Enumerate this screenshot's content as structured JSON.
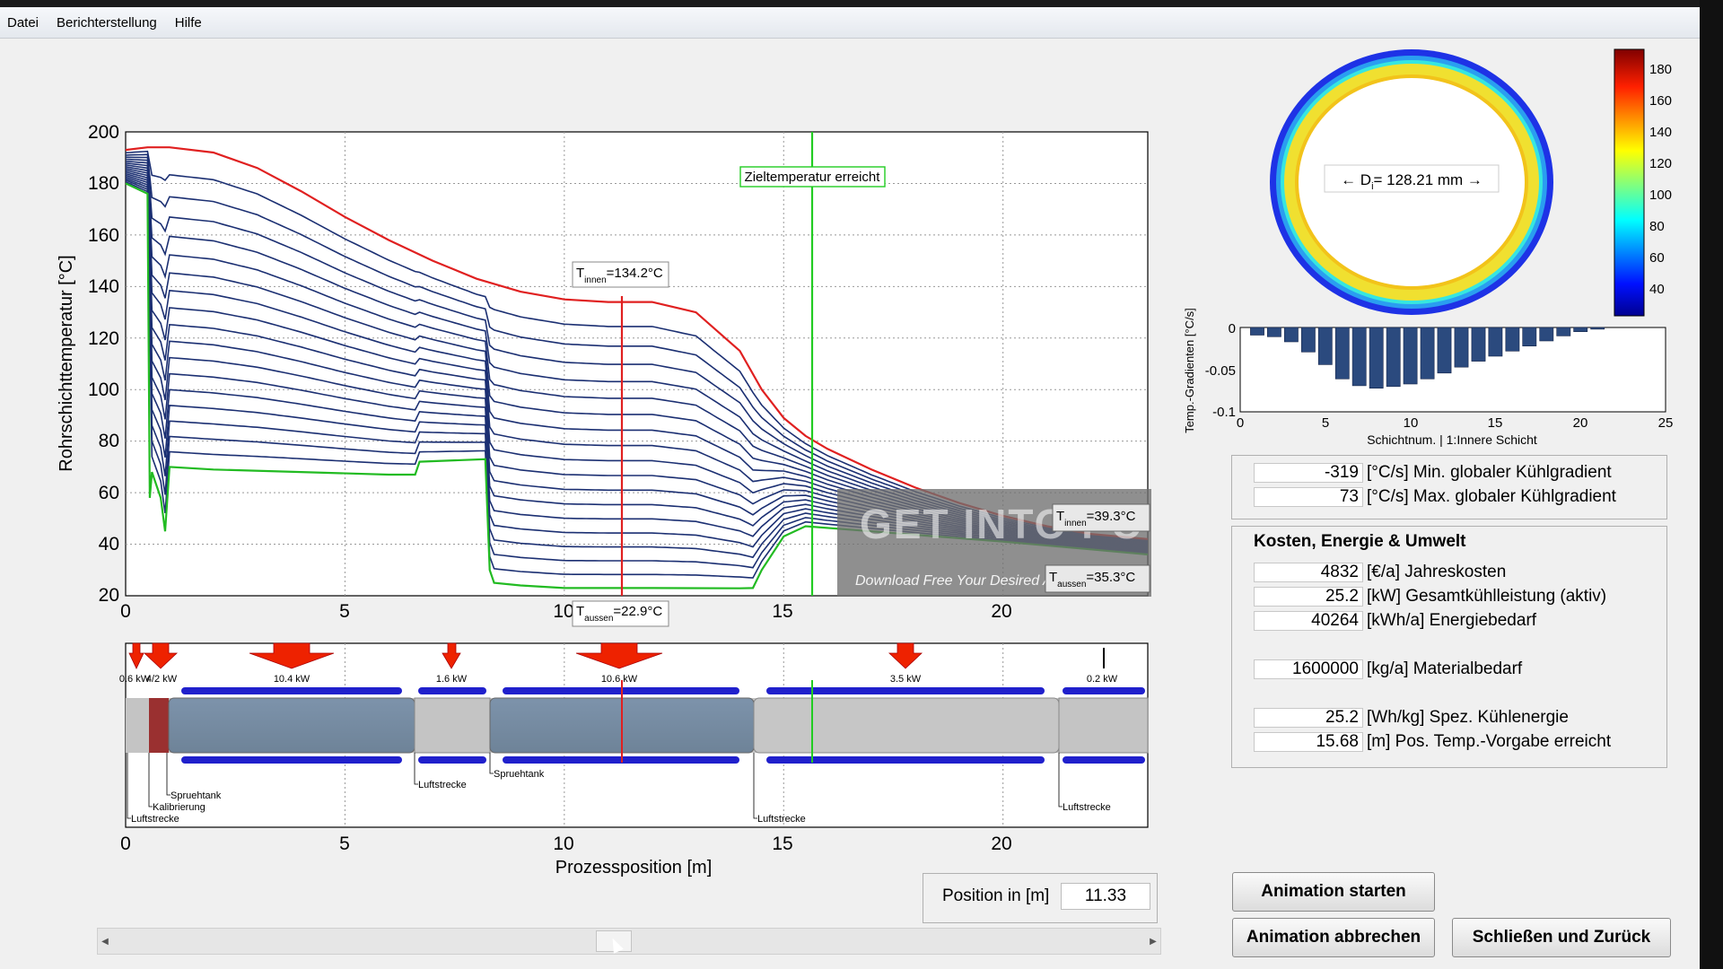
{
  "menu": [
    "Datei",
    "Berichterstellung",
    "Hilfe"
  ],
  "main_plot": {
    "ylabel": "Rohrschichttemperatur [°C]",
    "yticks": [
      "200",
      "180",
      "160",
      "140",
      "120",
      "100",
      "80",
      "60",
      "40",
      "20"
    ],
    "xticks": [
      "0",
      "5",
      "10",
      "15",
      "20"
    ],
    "annotations": {
      "target": "Zieltemperatur erreicht",
      "t_inner_main": "=134.2°C",
      "t_outer_main": "=22.9°C",
      "t_inner_end": "=39.3°C",
      "t_outer_end": "=35.3°C",
      "t_prefix": "T",
      "sub_inner": "innen",
      "sub_outer": "aussen"
    }
  },
  "process_plot": {
    "xlabel": "Prozessposition [m]",
    "xticks": [
      "0",
      "5",
      "10",
      "15",
      "20"
    ],
    "power_labels": [
      "0.6 kW",
      "4/2 kW",
      "10.4 kW",
      "1.6 kW",
      "10.6 kW",
      "3.5 kW",
      "0.2 kW"
    ],
    "zones": [
      "Luftstrecke",
      "Kalibrierung",
      "Spruehtank",
      "Luftstrecke",
      "Spruehtank",
      "Luftstrecke",
      "Luftstrecke"
    ]
  },
  "cross_section": {
    "label": "← D",
    "label_sub": "i",
    "label_value": "= 128.21 mm →"
  },
  "colorbar": {
    "ticks": [
      "180",
      "160",
      "140",
      "120",
      "100",
      "80",
      "60",
      "40"
    ]
  },
  "gradient_plot": {
    "ylabel": "Temp.-Gradienten [°C/s]",
    "xlabel": "Schichtnum. | 1:Innere Schicht",
    "yticks": [
      "0",
      "-0.05",
      "-0.1"
    ],
    "xticks": [
      "0",
      "5",
      "10",
      "15",
      "20",
      "25"
    ]
  },
  "chart_data": [
    {
      "type": "line",
      "title": "",
      "xlabel": "",
      "ylabel": "Rohrschichttemperatur [°C]",
      "xlim": [
        0,
        23.3
      ],
      "ylim": [
        20,
        200
      ],
      "series": [
        {
          "color": "#e02020",
          "x": [
            0,
            0.5,
            1,
            2,
            3,
            4,
            5,
            6,
            7,
            8,
            9,
            10,
            11,
            12,
            13,
            14,
            14.5,
            15,
            15.5,
            16,
            17,
            18,
            19,
            20,
            21,
            22,
            23.3
          ],
          "y": [
            193,
            194,
            194,
            192,
            186,
            177,
            167,
            158,
            150,
            143,
            138,
            135,
            134,
            134,
            130,
            115,
            100,
            89,
            82,
            77,
            69,
            62,
            56,
            51,
            47,
            44,
            42
          ]
        },
        {
          "color": "#22bb22",
          "x": [
            0,
            0.5,
            0.55,
            0.6,
            0.8,
            0.9,
            1,
            2,
            4,
            6,
            6.6,
            6.7,
            8.2,
            8.3,
            8.4,
            9,
            10,
            12,
            14,
            14.3,
            14.5,
            15,
            15.5,
            17,
            20,
            22,
            23.3
          ],
          "y": [
            180,
            176,
            58,
            68,
            58,
            45,
            70,
            69,
            68,
            67,
            67,
            72,
            73,
            30,
            25,
            24,
            23,
            23,
            22.9,
            23,
            30,
            43,
            47,
            45,
            41,
            38,
            36
          ]
        }
      ]
    },
    {
      "type": "bar",
      "title": "",
      "xlabel": "Schichtnum. | 1:Innere Schicht",
      "ylabel": "Temp.-Gradienten [°C/s]",
      "ylim": [
        -0.1,
        0
      ],
      "categories": [
        1,
        2,
        3,
        4,
        5,
        6,
        7,
        8,
        9,
        10,
        11,
        12,
        13,
        14,
        15,
        16,
        17,
        18,
        19,
        20,
        21
      ],
      "values": [
        -0.009,
        -0.011,
        -0.017,
        -0.029,
        -0.044,
        -0.061,
        -0.069,
        -0.072,
        -0.07,
        -0.067,
        -0.061,
        -0.054,
        -0.047,
        -0.04,
        -0.034,
        -0.028,
        -0.022,
        -0.016,
        -0.01,
        -0.005,
        -0.002
      ]
    },
    {
      "type": "heatmap",
      "title": "",
      "xlabel": "",
      "ylabel": "",
      "colorbar": [
        40,
        190
      ]
    }
  ],
  "stats": {
    "rows": [
      {
        "value": "-319",
        "label": "[°C/s] Min. globaler Kühlgradient"
      },
      {
        "value": "73",
        "label": "[°C/s] Max. globaler Kühlgradient"
      }
    ]
  },
  "costs": {
    "title": "Kosten, Energie & Umwelt",
    "rows": [
      {
        "value": "4832",
        "label": "[€/a] Jahreskosten"
      },
      {
        "value": "25.2",
        "label": "[kW] Gesamtkühlleistung (aktiv)"
      },
      {
        "value": "40264",
        "label": "[kWh/a] Energiebedarf"
      },
      {
        "value": "1600000",
        "label": "[kg/a] Materialbedarf"
      },
      {
        "value": "25.2",
        "label": "[Wh/kg] Spez. Kühlenergie"
      },
      {
        "value": "15.68",
        "label": "[m] Pos. Temp.-Vorgabe erreicht"
      }
    ]
  },
  "position": {
    "label": "Position in [m]",
    "value": "11.33"
  },
  "buttons": {
    "start": "Animation starten",
    "abort": "Animation abbrechen",
    "close": "Schließen und Zurück"
  },
  "watermark": {
    "logo": "GET INTO PC",
    "tagline": "Download Free Your Desired App"
  }
}
